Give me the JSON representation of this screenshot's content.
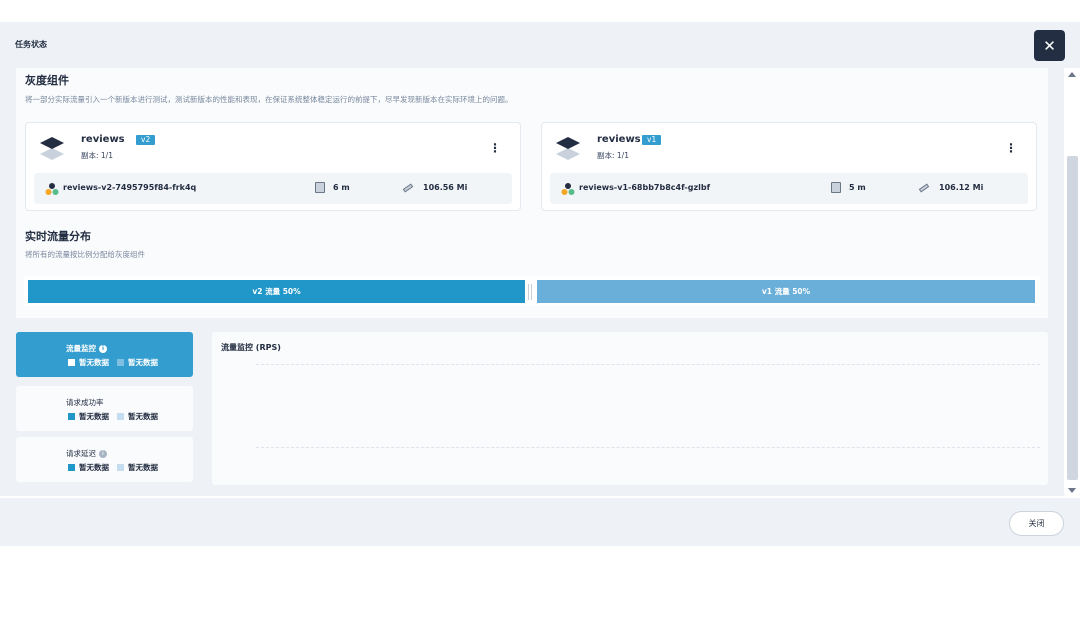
{
  "header": {
    "title": "任务状态",
    "close_symbol": "✕"
  },
  "gray_component": {
    "title": "灰度组件",
    "description": "将一部分实际流量引入一个新版本进行测试，测试新版本的性能和表现，在保证系统整体稳定运行的前提下，尽早发现新版本在实际环境上的问题。",
    "cards": [
      {
        "name": "reviews",
        "version": "v2",
        "replicas": "副本: 1/1",
        "pod": "reviews-v2-7495795f84-frk4q",
        "age": "6 m",
        "memory": "106.56 Mi"
      },
      {
        "name": "reviews",
        "version": "v1",
        "replicas": "副本: 1/1",
        "pod": "reviews-v1-68bb7b8c4f-gzlbf",
        "age": "5 m",
        "memory": "106.12 Mi"
      }
    ]
  },
  "traffic": {
    "title": "实时流量分布",
    "description": "将所有的流量按比例分配给灰度组件",
    "v2_label": "v2 流量 50%",
    "v1_label": "v1 流量 50%",
    "v2_percent": 50,
    "v1_percent": 50
  },
  "metrics": {
    "tabs": [
      {
        "title": "流量监控",
        "legend_a": "暂无数据",
        "legend_b": "暂无数据",
        "active": true,
        "info": true
      },
      {
        "title": "请求成功率",
        "legend_a": "暂无数据",
        "legend_b": "暂无数据",
        "active": false,
        "info": false
      },
      {
        "title": "请求延迟",
        "legend_a": "暂无数据",
        "legend_b": "暂无数据",
        "active": false,
        "info": true
      }
    ],
    "chart_title": "流量监控 (RPS)"
  },
  "footer": {
    "close_label": "关闭"
  },
  "colors": {
    "accent": "#329dce",
    "v2": "#2196c9",
    "v1": "#6aafd9",
    "dark": "#242e42"
  },
  "icons": [
    "close-icon",
    "layers-icon",
    "more-icon",
    "pod-icon",
    "clock-icon",
    "memory-icon",
    "info-icon"
  ]
}
